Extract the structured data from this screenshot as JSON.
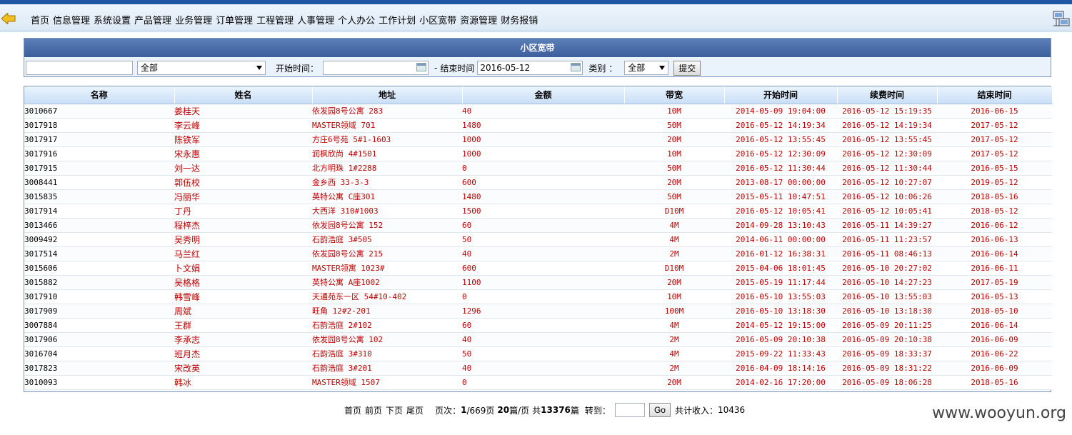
{
  "nav": {
    "items": [
      "首页",
      "信息管理",
      "系统设置",
      "产品管理",
      "业务管理",
      "订单管理",
      "工程管理",
      "人事管理",
      "个人办公",
      "工作计划",
      "小区宽带",
      "资源管理",
      "财务报销"
    ]
  },
  "panel": {
    "title": "小区宽带",
    "keyword_value": "",
    "scope_select": "全部",
    "start_label": "开始时间：",
    "start_value": "",
    "dash": "-",
    "end_label": "结束时间",
    "end_value": "2016-05-12",
    "type_label": "类别 ：",
    "type_select": "全部",
    "submit_label": "提交"
  },
  "table": {
    "headers": [
      "名称",
      "姓名",
      "地址",
      "金额",
      "带宽",
      "开始时间",
      "续费时间",
      "结束时间"
    ],
    "rows": [
      [
        "3010667",
        "姜桂天",
        "依发园8号公寓 283",
        "40",
        "10M",
        "2014-05-09 19:04:00",
        "2016-05-12 15:19:35",
        "2016-06-15"
      ],
      [
        "3017918",
        "李云峰",
        "MASTER领域 701",
        "1480",
        "50M",
        "2016-05-12 14:19:34",
        "2016-05-12 14:19:34",
        "2017-05-12"
      ],
      [
        "3017917",
        "陈铁军",
        "方庄6号苑 5#1-1603",
        "1000",
        "20M",
        "2016-05-12 13:55:45",
        "2016-05-12 13:55:45",
        "2017-05-12"
      ],
      [
        "3017916",
        "宋永惠",
        "润枫欣尚 4#1501",
        "1000",
        "10M",
        "2016-05-12 12:30:09",
        "2016-05-12 12:30:09",
        "2017-05-12"
      ],
      [
        "3017915",
        "刘一达",
        "北方明珠 1#2288",
        "0",
        "50M",
        "2016-05-12 11:30:44",
        "2016-05-12 11:30:44",
        "2016-05-15"
      ],
      [
        "3008441",
        "郭伍校",
        "金乡西 33-3-3",
        "600",
        "20M",
        "2013-08-17 00:00:00",
        "2016-05-12 10:27:07",
        "2019-05-12"
      ],
      [
        "3015835",
        "冯丽华",
        "英特公寓 C座301",
        "1480",
        "50M",
        "2015-05-11 10:47:51",
        "2016-05-12 10:06:26",
        "2018-05-16"
      ],
      [
        "3017914",
        "丁丹",
        "大西洋 310#1003",
        "1500",
        "D10M",
        "2016-05-12 10:05:41",
        "2016-05-12 10:05:41",
        "2018-05-12"
      ],
      [
        "3013466",
        "程梓杰",
        "依发园8号公寓 152",
        "60",
        "4M",
        "2014-09-28 13:10:43",
        "2016-05-11 14:39:27",
        "2016-06-12"
      ],
      [
        "3009492",
        "吴秀明",
        "石韵浩庭 3#505",
        "50",
        "4M",
        "2014-06-11 00:00:00",
        "2016-05-11 11:23:57",
        "2016-06-13"
      ],
      [
        "3017514",
        "马兰红",
        "依发园8号公寓 215",
        "40",
        "2M",
        "2016-01-12 16:38:31",
        "2016-05-11 08:46:13",
        "2016-06-14"
      ],
      [
        "3015606",
        "卜文娟",
        "MASTER领寓 1023#",
        "600",
        "D10M",
        "2015-04-06 18:01:45",
        "2016-05-10 20:27:02",
        "2016-06-11"
      ],
      [
        "3015882",
        "吴格格",
        "英特公寓 A座1002",
        "1100",
        "20M",
        "2015-05-19 11:17:44",
        "2016-05-10 14:27:23",
        "2017-05-19"
      ],
      [
        "3017910",
        "韩雪峰",
        "天通苑东一区 54#10-402",
        "0",
        "10M",
        "2016-05-10 13:55:03",
        "2016-05-10 13:55:03",
        "2016-05-13"
      ],
      [
        "3017909",
        "周斌",
        "旺角 12#2-201",
        "1296",
        "100M",
        "2016-05-10 13:18:30",
        "2016-05-10 13:18:30",
        "2018-05-10"
      ],
      [
        "3007884",
        "王群",
        "石韵浩庭 2#102",
        "60",
        "4M",
        "2014-05-12 19:15:00",
        "2016-05-09 20:11:25",
        "2016-06-14"
      ],
      [
        "3017906",
        "李承志",
        "依发园8号公寓 102",
        "40",
        "2M",
        "2016-05-09 20:10:38",
        "2016-05-09 20:10:38",
        "2016-06-09"
      ],
      [
        "3016704",
        "班月杰",
        "石韵浩庭 3#310",
        "50",
        "4M",
        "2015-09-22 11:33:43",
        "2016-05-09 18:33:37",
        "2016-06-22"
      ],
      [
        "3017823",
        "宋改英",
        "石韵浩庭 3#201",
        "40",
        "2M",
        "2016-04-09 18:14:16",
        "2016-05-09 18:31:22",
        "2016-06-09"
      ],
      [
        "3010093",
        "韩冰",
        "MASTER领域 1507",
        "0",
        "20M",
        "2014-02-16 17:20:00",
        "2016-05-09 18:06:28",
        "2018-05-16"
      ]
    ]
  },
  "pager": {
    "first": "首页",
    "prev": "前页",
    "next": "下页",
    "last": "尾页",
    "page_prefix": "页次：",
    "page_current": "1",
    "page_total": "/669页",
    "page_size": "20",
    "page_size_suffix": "篇/页",
    "total_prefix": "共",
    "total_count": "13376",
    "total_suffix": "篇",
    "goto_label": "转到：",
    "go_label": "Go",
    "income_label": "共计收入：",
    "income_value": "10436"
  },
  "watermark": "www.wooyun.org",
  "colors": {
    "accent": "#1f57a5",
    "panel_header": "#3c5f9c",
    "cell_text": "#c00000"
  }
}
